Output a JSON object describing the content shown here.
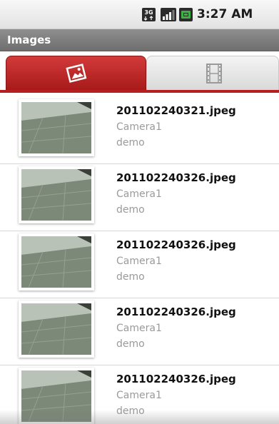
{
  "status_bar": {
    "network_type_icon": "3g-icon",
    "signal_icon": "signal-strength-icon",
    "battery_icon": "battery-charging-icon",
    "time": "3:27 AM"
  },
  "title_bar": {
    "title": "Images"
  },
  "tabs": [
    {
      "icon": "image-icon",
      "selected": true
    },
    {
      "icon": "film-icon",
      "selected": false
    }
  ],
  "colors": {
    "accent": "#b81f1f",
    "secondary_text": "#9a9a9a",
    "title_bar": "#7f7f7f"
  },
  "images": [
    {
      "filename": "201102240321.jpeg",
      "camera": "Camera1",
      "user": "demo"
    },
    {
      "filename": "201102240326.jpeg",
      "camera": "Camera1",
      "user": "demo"
    },
    {
      "filename": "201102240326.jpeg",
      "camera": "Camera1",
      "user": "demo"
    },
    {
      "filename": "201102240326.jpeg",
      "camera": "Camera1",
      "user": "demo"
    },
    {
      "filename": "201102240326.jpeg",
      "camera": "Camera1",
      "user": "demo"
    }
  ]
}
